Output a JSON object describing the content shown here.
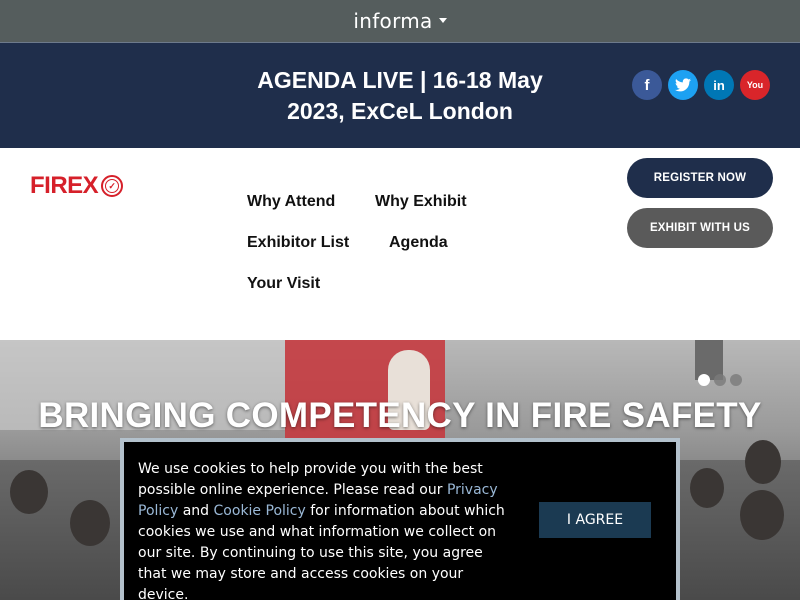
{
  "topbar": {
    "brand": "informa"
  },
  "banner": {
    "title": "AGENDA LIVE | 16-18 May 2023, ExCeL London",
    "socials": [
      {
        "name": "facebook",
        "glyph": "f"
      },
      {
        "name": "twitter",
        "glyph": "t"
      },
      {
        "name": "linkedin",
        "glyph": "in"
      },
      {
        "name": "youtube",
        "glyph": "You"
      }
    ]
  },
  "header": {
    "logo_text": "FIREX",
    "nav": {
      "why_attend": "Why Attend",
      "why_exhibit": "Why Exhibit",
      "exhibitor_list": "Exhibitor List",
      "agenda": "Agenda",
      "your_visit": "Your Visit"
    },
    "register_label": "REGISTER NOW",
    "exhibit_label": "EXHIBIT WITH US"
  },
  "hero": {
    "title": "BRINGING COMPETENCY IN FIRE SAFETY",
    "slides": 3,
    "active_slide": 1
  },
  "cookie": {
    "text_1": "We use cookies to help provide you with the best possible online experience. Please read our ",
    "privacy_link": "Privacy Policy",
    "text_2": " and ",
    "cookie_link": "Cookie Policy",
    "text_3": " for information about which cookies we use and what information we collect on our site. By continuing to use this site, you agree that we may store and access cookies on your device.",
    "agree_label": "I AGREE"
  },
  "colors": {
    "topbar": "#555d5d",
    "banner": "#1f2e4b",
    "brand_red": "#d6202a",
    "register_button": "#1f2e4b",
    "exhibit_button": "#5a5a5a",
    "agree_button": "#1b3a52"
  }
}
